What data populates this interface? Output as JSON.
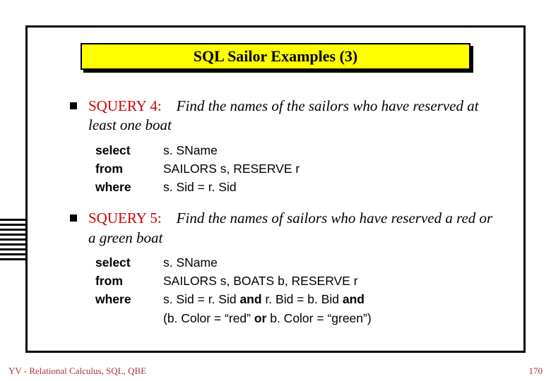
{
  "title": "SQL Sailor Examples (3)",
  "items": [
    {
      "label": "SQUERY 4:",
      "desc": "Find the names of the sailors who have reserved at least one boat",
      "sql": {
        "select_kw": "select",
        "select_val": "s. SName",
        "from_kw": "from",
        "from_val": "SAILORS s,  RESERVE r",
        "where_kw": "where",
        "where_val": "s. Sid = r. Sid"
      }
    },
    {
      "label": "SQUERY 5:",
      "desc": "Find the names of sailors who have reserved a red or a green boat",
      "sql": {
        "select_kw": "select",
        "select_val": "s. SName",
        "from_kw": "from",
        "from_val": "SAILORS s,  BOATS b, RESERVE r",
        "where_kw": "where",
        "where_pre": "s. Sid = r. Sid ",
        "and1": "and",
        "where_mid": " r. Bid = b. Bid ",
        "and2": "and",
        "where2_pre": "(b. Color = “red”  ",
        "or": "or",
        "where2_post": "  b. Color = “green”)"
      }
    }
  ],
  "footer": {
    "left": "YV  -  Relational Calculus, SQL, QBE",
    "right": "170"
  }
}
